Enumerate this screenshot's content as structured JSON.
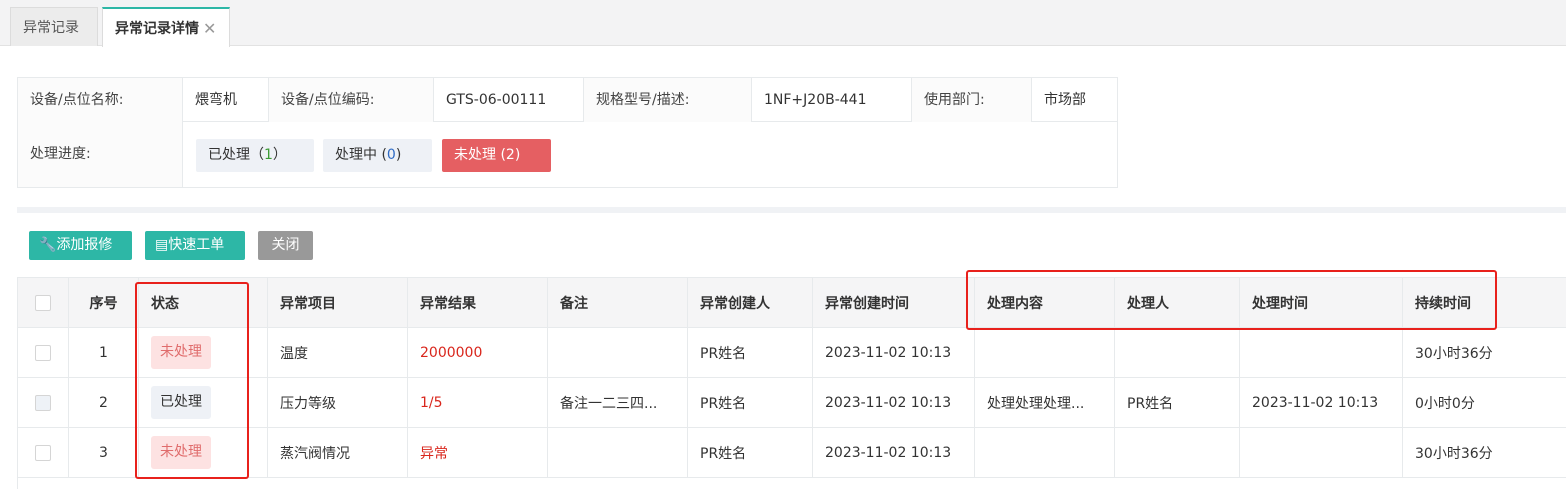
{
  "tabs": [
    {
      "label": "异常记录"
    },
    {
      "label": "异常记录详情",
      "close": "✕"
    }
  ],
  "info": {
    "device_name_label": "设备/点位名称:",
    "device_name": "煨弯机",
    "device_code_label": "设备/点位编码:",
    "device_code": "GTS-06-00111",
    "spec_label": "规格型号/描述:",
    "spec": "1NF+J20B-441",
    "dept_label": "使用部门:",
    "dept": "市场部",
    "progress_label": "处理进度:",
    "progress": {
      "done_label": "已处理",
      "done_count": "1",
      "doing_label": "处理中",
      "doing_count": "0",
      "todo_label": "未处理",
      "todo_count": "2"
    }
  },
  "toolbar": {
    "add_label": "添加报修",
    "quick_label": "快速工单",
    "close_label": "关闭"
  },
  "table": {
    "headers": [
      "序号",
      "状态",
      "异常项目",
      "异常结果",
      "备注",
      "异常创建人",
      "异常创建时间",
      "处理内容",
      "处理人",
      "处理时间",
      "持续时间"
    ],
    "rows": [
      {
        "no": "1",
        "status": "未处理",
        "item": "温度",
        "result": "2000000",
        "note": "",
        "creator": "PR姓名",
        "created": "2023-11-02 10:13",
        "content": "",
        "handler": "",
        "handled": "",
        "duration": "30小时36分"
      },
      {
        "no": "2",
        "status": "已处理",
        "item": "压力等级",
        "result": "1/5",
        "note": "备注一二三四...",
        "creator": "PR姓名",
        "created": "2023-11-02 10:13",
        "content": "处理处理处理...",
        "handler": "PR姓名",
        "handled": "2023-11-02 10:13",
        "duration": "0小时0分"
      },
      {
        "no": "3",
        "status": "未处理",
        "item": "蒸汽阀情况",
        "result": "异常",
        "note": "",
        "creator": "PR姓名",
        "created": "2023-11-02 10:13",
        "content": "",
        "handler": "",
        "handled": "",
        "duration": "30小时36分"
      }
    ]
  },
  "colors": {
    "accent": "#2db7a6",
    "danger": "#e55f62",
    "highlight": "#e8211c"
  }
}
